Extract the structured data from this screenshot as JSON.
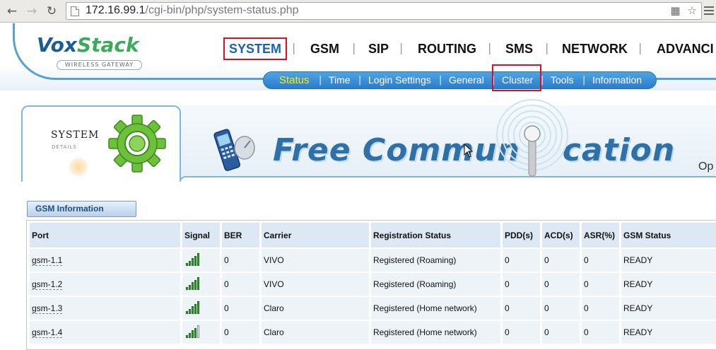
{
  "browser": {
    "url_host": "172.16.99.1",
    "url_path": "/cgi-bin/php/system-status.php"
  },
  "brand": {
    "logo_part1": "Vox",
    "logo_part2": "Stack",
    "tagline": "WIRELESS GATEWAY"
  },
  "mainnav": {
    "items": [
      "SYSTEM",
      "GSM",
      "SIP",
      "ROUTING",
      "SMS",
      "NETWORK",
      "ADVANCI"
    ],
    "active": "SYSTEM",
    "separator": "|"
  },
  "subnav": {
    "items": [
      "Status",
      "Time",
      "Login Settings",
      "General",
      "Cluster",
      "Tools",
      "Information"
    ],
    "current": "Status",
    "separator": "|"
  },
  "banner": {
    "title": "SYSTEM",
    "subtitle": "DETAILS",
    "slogan_part1": "Free Commun",
    "slogan_part2": "cation",
    "edge_text": "Op"
  },
  "gsm_section": {
    "tab_label": "GSM Information",
    "columns": [
      "Port",
      "Signal",
      "BER",
      "Carrier",
      "Registration Status",
      "PDD(s)",
      "ACD(s)",
      "ASR(%)",
      "GSM Status"
    ],
    "rows": [
      {
        "port": "gsm-1.1",
        "signal_bars": 5,
        "ber": "0",
        "carrier": "VIVO",
        "registration": "Registered (Roaming)",
        "pdd": "0",
        "acd": "0",
        "asr": "0",
        "status": "READY"
      },
      {
        "port": "gsm-1.2",
        "signal_bars": 5,
        "ber": "0",
        "carrier": "VIVO",
        "registration": "Registered (Roaming)",
        "pdd": "0",
        "acd": "0",
        "asr": "0",
        "status": "READY"
      },
      {
        "port": "gsm-1.3",
        "signal_bars": 5,
        "ber": "0",
        "carrier": "Claro",
        "registration": "Registered (Home network)",
        "pdd": "0",
        "acd": "0",
        "asr": "0",
        "status": "READY"
      },
      {
        "port": "gsm-1.4",
        "signal_bars": 4,
        "ber": "0",
        "carrier": "Claro",
        "registration": "Registered (Home network)",
        "pdd": "0",
        "acd": "0",
        "asr": "0",
        "status": "READY"
      }
    ],
    "signal_max_bars": 5
  },
  "colors": {
    "highlight_box": "#e0101a",
    "brand_blue": "#1a5c95",
    "brand_green": "#3baa5a",
    "current_subnav": "#ffee00"
  },
  "icons": [
    "back-icon",
    "forward-icon",
    "reload-icon",
    "page-icon",
    "translate-icon",
    "bookmark-star-icon",
    "menu-icon",
    "gear-icon",
    "phone-icon",
    "antenna-icon",
    "signal-icon",
    "mouse-cursor-icon"
  ]
}
